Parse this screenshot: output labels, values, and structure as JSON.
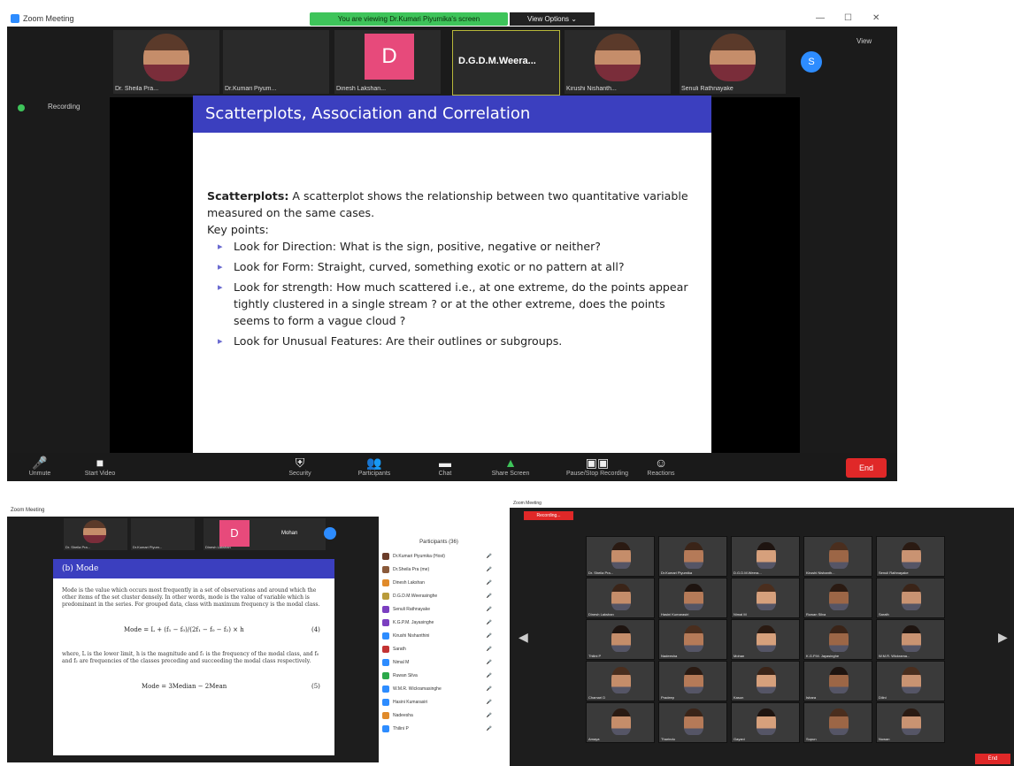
{
  "main": {
    "window_title": "Zoom Meeting",
    "share_banner": "You are viewing Dr.Kumari Piyumika's screen",
    "view_options": "View Options ⌄",
    "view_link": "View",
    "recording_label": "Recording",
    "participants": [
      {
        "name": "Dr. Sheila Pra...",
        "type": "video"
      },
      {
        "name": "Dr.Kumari Piyum...",
        "type": "blank"
      },
      {
        "name": "Dinesh Lakshan...",
        "type": "initial",
        "initial": "D"
      },
      {
        "name": "D.G.D.M.Weera...",
        "type": "name"
      },
      {
        "name": "Kirushi Nishanth...",
        "type": "video"
      },
      {
        "name": "Senuli Rathnayake",
        "type": "video"
      }
    ],
    "chat_avatar": "S",
    "slide": {
      "title": "Scatterplots, Association and Correlation",
      "intro_bold": "Scatterplots:",
      "intro_text": " A scatterplot shows the relationship between two quantitative variable measured on the same cases.",
      "key_points_label": "Key points:",
      "points": [
        "Look for Direction: What is the sign, positive, negative or neither?",
        "Look for Form: Straight, curved, something exotic or no pattern at all?",
        "Look for strength: How much scattered i.e., at one extreme, do the points appear tightly clustered in a single stream ? or at the other extreme, does the points seems to form a vague cloud ?",
        "Look for Unusual Features: Are their outlines or subgroups."
      ]
    },
    "toolbar": [
      {
        "label": "Unmute",
        "icon": "mic-icon",
        "glyph": "🎤"
      },
      {
        "label": "Start Video",
        "icon": "video-icon",
        "glyph": "■"
      },
      {
        "label": "Security",
        "icon": "shield-icon",
        "glyph": "⛨"
      },
      {
        "label": "Participants",
        "icon": "participants-icon",
        "glyph": "👥"
      },
      {
        "label": "Chat",
        "icon": "chat-icon",
        "glyph": "▬"
      },
      {
        "label": "Share Screen",
        "icon": "share-screen-icon",
        "glyph": "▲"
      },
      {
        "label": "Pause/Stop Recording",
        "icon": "recording-icon",
        "glyph": "▣▣"
      },
      {
        "label": "Reactions",
        "icon": "reactions-icon",
        "glyph": "☺"
      }
    ],
    "end_label": "End"
  },
  "bottom_left": {
    "window_title": "Zoom Meeting",
    "slide_title": "(b) Mode",
    "para1": "Mode is the value which occurs most frequently in a set of observations and around which the other items of the set cluster densely. In other words, mode is the value of variable which is predominant in the series. For grouped data, class with maximum frequency is the modal class.",
    "eq1": "Mode = L + (f₁ − f₀)/(2f₁ − f₀ − f₂) × h",
    "eq1_no": "(4)",
    "para2": "where, L is the lower limit, h is the magnitude and f₁ is the frequency of the modal class, and f₀ and f₂ are frequencies of the classes preceding and succeeding the modal class respectively.",
    "eq2": "Mode = 3Median − 2Mean",
    "eq2_no": "(5)",
    "panel_title": "Participants (36)",
    "participants": [
      {
        "name": "Dr.Kumari Piyumika (Host)",
        "color": "#6b3d2a"
      },
      {
        "name": "Dr.Sheila Pra (me)",
        "color": "#8a5a3a"
      },
      {
        "name": "Dinesh Lakshan",
        "color": "#e08a2a"
      },
      {
        "name": "D.G.D.M.Weerasinghe",
        "color": "#b99b3a"
      },
      {
        "name": "Senuli Rathnayake",
        "color": "#7b3fc0"
      },
      {
        "name": "K.G.P.M. Jayasinghe",
        "color": "#7b3fc0"
      },
      {
        "name": "Kirushi Nishanthini",
        "color": "#2d8cff"
      },
      {
        "name": "Sarath",
        "color": "#c33333"
      },
      {
        "name": "Nimal M",
        "color": "#2d8cff"
      },
      {
        "name": "Ruwan Silva",
        "color": "#2ba84a"
      },
      {
        "name": "W.M.R. Wickramasinghe",
        "color": "#2d8cff"
      },
      {
        "name": "Hasini Kumarasiri",
        "color": "#2d8cff"
      },
      {
        "name": "Nadeesha",
        "color": "#e08a2a"
      },
      {
        "name": "Thilini P",
        "color": "#2d8cff"
      }
    ],
    "thumb_names": [
      "Dr. Sheila Pra...",
      "Dr.Kumari Piyum...",
      "Dinesh Lakshan",
      "Mohan"
    ],
    "initial": "D"
  },
  "bottom_right": {
    "window_title": "Zoom Meeting",
    "recording_label": "Recording...",
    "grid_names": [
      "Dr. Sheila Pra...",
      "Dr.Kumari Piyumika",
      "D.G.D.M.Weera...",
      "Kirushi Nishanth...",
      "Senuli Rathnayake",
      "Dinesh Lakshan",
      "Hasini Kumarasiri",
      "Nimal M",
      "Ruwan Silva",
      "Sarath",
      "Thilini P",
      "Nadeesha",
      "Mohan",
      "K.G.P.M. Jayasinghe",
      "W.M.R. Wickrama...",
      "Chamari D",
      "Pradeep",
      "Kasun",
      "Ishara",
      "Dilini",
      "Amaya",
      "Tharindu",
      "Gayani",
      "Supun",
      "Nuwan"
    ],
    "end_label": "End"
  },
  "colors": {
    "zoom_blue": "#2d8cff",
    "slide_header": "#3b3fbf",
    "share_green": "#3ec45a",
    "end_red": "#e02828"
  }
}
